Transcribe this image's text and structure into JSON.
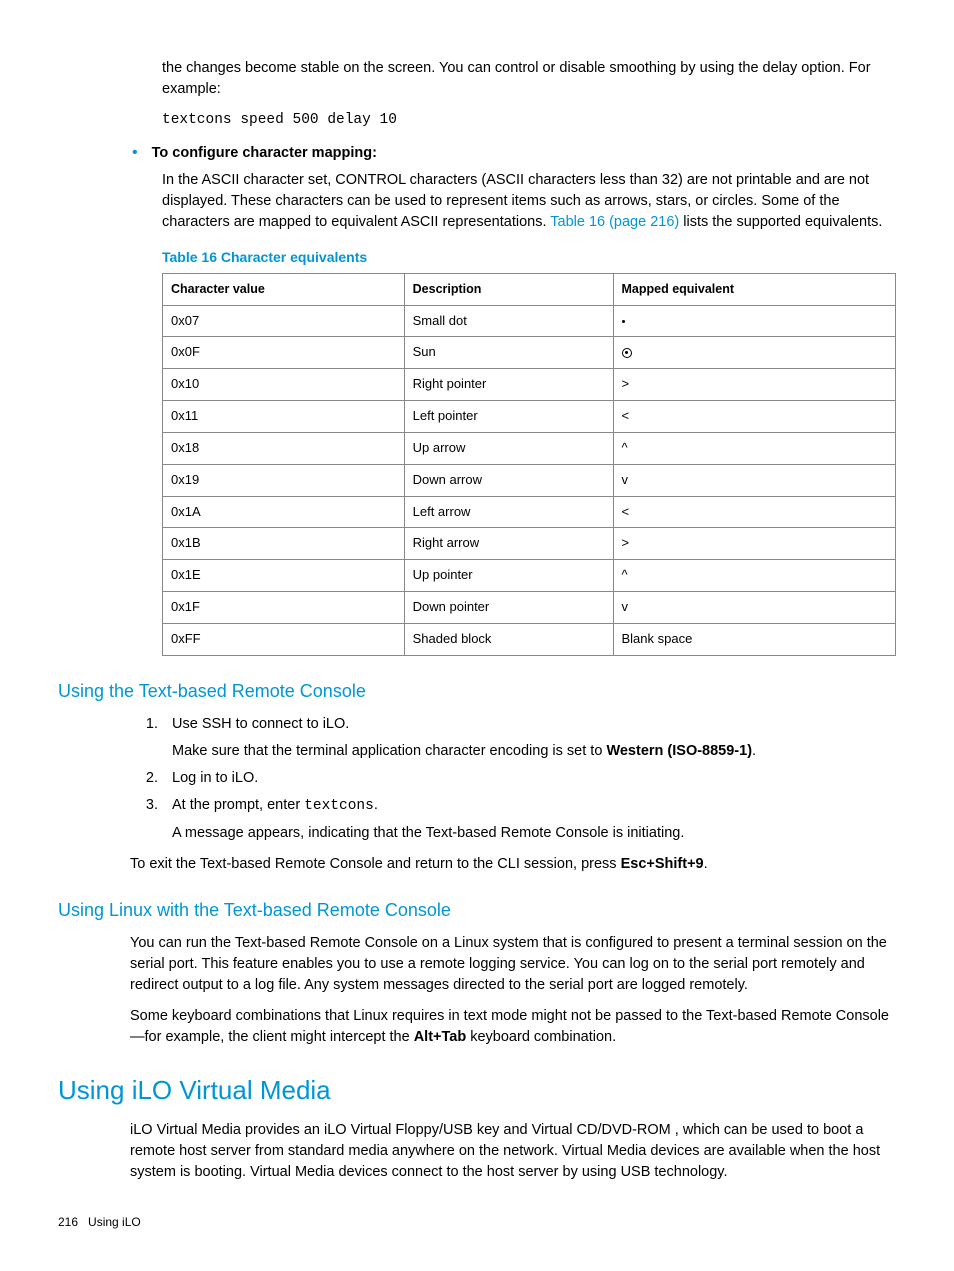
{
  "intro": {
    "p1": "the changes become stable on the screen. You can control or disable smoothing by using the delay option. For example:",
    "code1": "textcons speed 500 delay 10"
  },
  "bullet": {
    "heading": "To configure character mapping:",
    "body_before_link": "In the ASCII character set, CONTROL characters (ASCII characters less than 32) are not printable and are not displayed. These characters can be used to represent items such as arrows, stars, or circles. Some of the characters are mapped to equivalent ASCII representations. ",
    "link": "Table 16 (page 216)",
    "body_after_link": " lists the supported equivalents."
  },
  "table": {
    "caption": "Table 16 Character equivalents",
    "headers": [
      "Character value",
      "Description",
      "Mapped equivalent"
    ],
    "rows": [
      [
        "0x07",
        "Small dot",
        "."
      ],
      [
        "0x0F",
        "Sun",
        "⊙"
      ],
      [
        "0x10",
        "Right pointer",
        ">"
      ],
      [
        "0x11",
        "Left pointer",
        "<"
      ],
      [
        "0x18",
        "Up arrow",
        "^"
      ],
      [
        "0x19",
        "Down arrow",
        "v"
      ],
      [
        "0x1A",
        "Left arrow",
        "<"
      ],
      [
        "0x1B",
        "Right arrow",
        ">"
      ],
      [
        "0x1E",
        "Up pointer",
        "^"
      ],
      [
        "0x1F",
        "Down pointer",
        "v"
      ],
      [
        "0xFF",
        "Shaded block",
        "Blank space"
      ]
    ]
  },
  "sec1": {
    "title": "Using the Text-based Remote Console",
    "step1a": "Use SSH to connect to iLO.",
    "step1b_before": "Make sure that the terminal application character encoding is set to ",
    "step1b_bold": "Western (ISO-8859-1)",
    "step1b_after": ".",
    "step2": "Log in to iLO.",
    "step3a": "At the prompt, enter ",
    "step3a_code": "textcons",
    "step3a_after": ".",
    "step3b": "A message appears, indicating that the Text-based Remote Console is initiating.",
    "exit_before": "To exit the Text-based Remote Console and return to the CLI session, press ",
    "exit_bold": "Esc+Shift+9",
    "exit_after": "."
  },
  "sec2": {
    "title": "Using Linux with the Text-based Remote Console",
    "p1": "You can run the Text-based Remote Console on a Linux system that is configured to present a terminal session on the serial port. This feature enables you to use a remote logging service. You can log on to the serial port remotely and redirect output to a log file. Any system messages directed to the serial port are logged remotely.",
    "p2_before": "Some keyboard combinations that Linux requires in text mode might not be passed to the Text-based Remote Console—for example, the client might intercept the ",
    "p2_bold": "Alt+Tab",
    "p2_after": " keyboard combination."
  },
  "sec3": {
    "title": "Using iLO Virtual Media",
    "p1": "iLO Virtual Media provides an iLO Virtual Floppy/USB key and Virtual CD/DVD-ROM , which can be used to boot a remote host server from standard media anywhere on the network. Virtual Media devices are available when the host system is booting. Virtual Media devices connect to the host server by using USB technology."
  },
  "footer": {
    "page": "216",
    "section": "Using iLO"
  },
  "chart_data": {
    "type": "table",
    "title": "Table 16 Character equivalents",
    "columns": [
      "Character value",
      "Description",
      "Mapped equivalent"
    ],
    "rows": [
      {
        "value": "0x07",
        "description": "Small dot",
        "mapped": "."
      },
      {
        "value": "0x0F",
        "description": "Sun",
        "mapped": "⊙"
      },
      {
        "value": "0x10",
        "description": "Right pointer",
        "mapped": ">"
      },
      {
        "value": "0x11",
        "description": "Left pointer",
        "mapped": "<"
      },
      {
        "value": "0x18",
        "description": "Up arrow",
        "mapped": "^"
      },
      {
        "value": "0x19",
        "description": "Down arrow",
        "mapped": "v"
      },
      {
        "value": "0x1A",
        "description": "Left arrow",
        "mapped": "<"
      },
      {
        "value": "0x1B",
        "description": "Right arrow",
        "mapped": ">"
      },
      {
        "value": "0x1E",
        "description": "Up pointer",
        "mapped": "^"
      },
      {
        "value": "0x1F",
        "description": "Down pointer",
        "mapped": "v"
      },
      {
        "value": "0xFF",
        "description": "Shaded block",
        "mapped": "Blank space"
      }
    ]
  }
}
